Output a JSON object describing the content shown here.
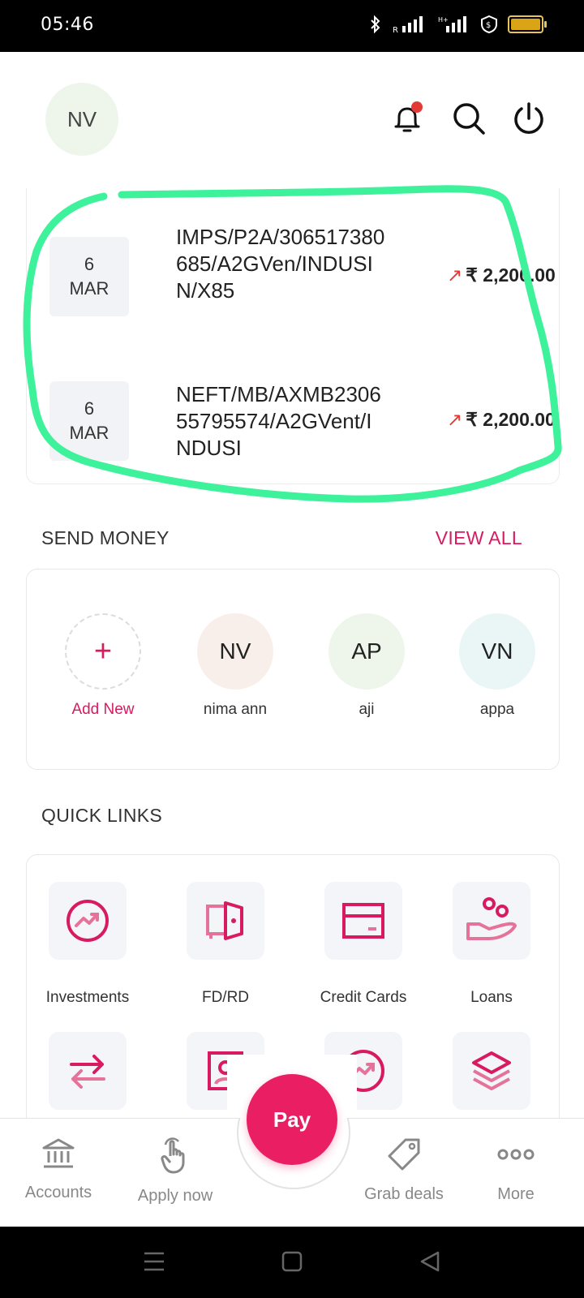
{
  "status_bar": {
    "time": "05:46"
  },
  "header": {
    "avatar_initials": "NV"
  },
  "transactions": [
    {
      "day": "6",
      "month": "MAR",
      "description": "IMPS/P2A/306517380685/A2GVen/INDUSIN/X85",
      "amount": "₹ 2,200.00"
    },
    {
      "day": "6",
      "month": "MAR",
      "description": "NEFT/MB/AXMB230655795574/A2GVent/INDUSI",
      "amount": "₹ 2,200.00"
    }
  ],
  "send_money": {
    "title": "SEND MONEY",
    "view_all": "VIEW ALL",
    "add_new": "Add New",
    "payees": [
      {
        "initials": "NV",
        "name": "nima ann",
        "color": "#f8efea"
      },
      {
        "initials": "AP",
        "name": "aji",
        "color": "#eef6ec"
      },
      {
        "initials": "VN",
        "name": "appa",
        "color": "#eaf6f6"
      }
    ]
  },
  "quick_links": {
    "title": "QUICK LINKS",
    "items": [
      {
        "label": "Investments",
        "icon": "investments-icon"
      },
      {
        "label": "FD/RD",
        "icon": "vault-icon"
      },
      {
        "label": "Credit Cards",
        "icon": "credit-card-icon"
      },
      {
        "label": "Loans",
        "icon": "loan-hand-icon"
      },
      {
        "label": "",
        "icon": "transfer-icon"
      },
      {
        "label": "",
        "icon": "profile-card-icon"
      },
      {
        "label": "",
        "icon": "investments-icon"
      },
      {
        "label": "",
        "icon": "layers-icon"
      }
    ]
  },
  "bottom_nav": {
    "accounts": "Accounts",
    "apply_now": "Apply now",
    "pay": "Pay",
    "grab_deals": "Grab deals",
    "more": "More"
  },
  "colors": {
    "accent": "#d81b60",
    "pay_button": "#e91e63",
    "highlight": "#3df29a"
  }
}
